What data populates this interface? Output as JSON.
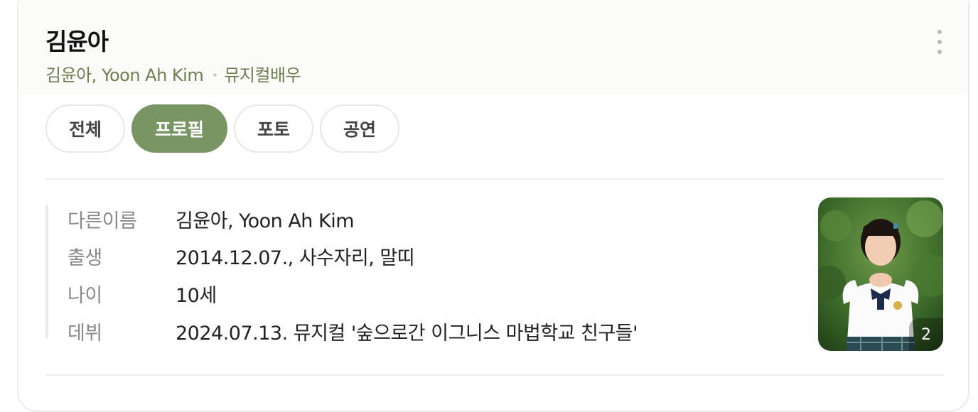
{
  "profile": {
    "name": "김윤아",
    "subtitle_names": "김윤아, Yoon Ah Kim",
    "subtitle_role": "뮤지컬배우",
    "more_icon": "more-vertical-icon"
  },
  "tabs": [
    {
      "label": "전체",
      "active": false
    },
    {
      "label": "프로필",
      "active": true
    },
    {
      "label": "포토",
      "active": false
    },
    {
      "label": "공연",
      "active": false
    }
  ],
  "info_rows": [
    {
      "label": "다른이름",
      "value": "김윤아, Yoon Ah Kim"
    },
    {
      "label": "출생",
      "value": "2014.12.07., 사수자리, 말띠"
    },
    {
      "label": "나이",
      "value": "10세"
    },
    {
      "label": "데뷔",
      "value": "2024.07.13. 뮤지컬 '숲으로간 이그니스 마법학교 친구들'"
    }
  ],
  "photo": {
    "count": "2"
  },
  "colors": {
    "accent": "#7a9564",
    "subtitle": "#6e7f52"
  }
}
